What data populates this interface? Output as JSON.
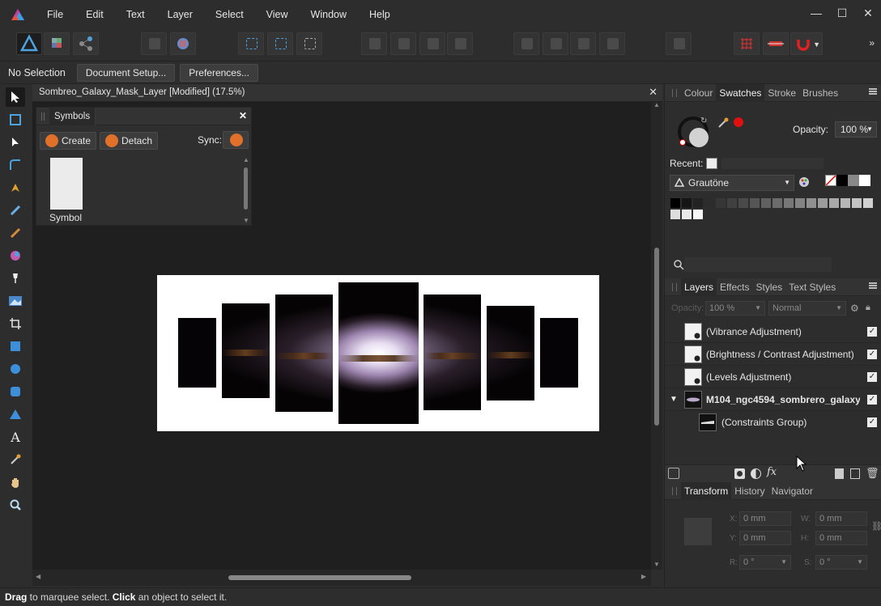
{
  "menu": {
    "items": [
      "File",
      "Edit",
      "Text",
      "Layer",
      "Select",
      "View",
      "Window",
      "Help"
    ]
  },
  "window_controls": {
    "minimize": "—",
    "maximize": "☐",
    "close": "✕"
  },
  "context_bar": {
    "selection": "No Selection",
    "document_setup": "Document Setup...",
    "preferences": "Preferences..."
  },
  "document": {
    "title": "Sombreo_Galaxy_Mask_Layer [Modified] (17.5%)",
    "close": "✕"
  },
  "symbols_panel": {
    "tab": "Symbols",
    "close": "✕",
    "create": "Create",
    "detach": "Detach",
    "sync_label": "Sync:",
    "symbol_name": "Symbol"
  },
  "colour_panel": {
    "tabs": [
      "Colour",
      "Swatches",
      "Stroke",
      "Brushes"
    ],
    "active_tab": "Swatches",
    "opacity_label": "Opacity:",
    "opacity_value": "100 %",
    "recent_label": "Recent:",
    "palette": "Grautöne",
    "swatch_colors": [
      "#000000",
      "#151515",
      "#222222",
      "#2c2c2c",
      "#363636",
      "#404040",
      "#4a4a4a",
      "#555555",
      "#606060",
      "#6b6b6b",
      "#777777",
      "#838383",
      "#909090",
      "#9c9c9c",
      "#a9a9a9",
      "#b6b6b6",
      "#c3c3c3",
      "#d0d0d0"
    ],
    "swatch_colors_row2": [
      "#dddddd",
      "#eaeaea",
      "#f6f6f6"
    ]
  },
  "layers_panel": {
    "tabs": [
      "Layers",
      "Effects",
      "Styles",
      "Text Styles"
    ],
    "active_tab": "Layers",
    "opacity_label": "Opacity:",
    "opacity_value": "100 %",
    "blend_mode": "Normal",
    "layers": [
      {
        "name": "(Vibrance Adjustment)"
      },
      {
        "name": "(Brightness / Contrast Adjustment)"
      },
      {
        "name": "(Levels Adjustment)"
      },
      {
        "name": "M104_ngc4594_sombrero_galaxy"
      },
      {
        "name": "(Constraints Group)"
      }
    ]
  },
  "transform_panel": {
    "tabs": [
      "Transform",
      "History",
      "Navigator"
    ],
    "active_tab": "Transform",
    "x_label": "X:",
    "x_value": "0 mm",
    "y_label": "Y:",
    "y_value": "0 mm",
    "w_label": "W:",
    "w_value": "0 mm",
    "h_label": "H:",
    "h_value": "0 mm",
    "r_label": "R:",
    "r_value": "0 °",
    "s_label": "S:",
    "s_value": "0 °"
  },
  "status": {
    "drag": "Drag",
    "text1": " to marquee select. ",
    "click": "Click",
    "text2": " an object to select it."
  },
  "colors": {
    "accent": "#4da3e0",
    "orange": "#e0702a",
    "red": "#e01010"
  }
}
